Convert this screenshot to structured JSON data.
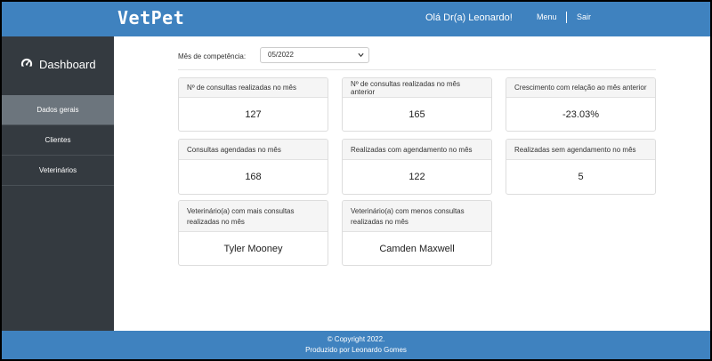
{
  "header": {
    "brand": "VetPet",
    "greeting": "Olá Dr(a) Leonardo!",
    "menu_label": "Menu",
    "logout_label": "Sair"
  },
  "sidebar": {
    "title": "Dashboard",
    "items": [
      {
        "label": "Dados gerais",
        "active": true
      },
      {
        "label": "Clientes",
        "active": false
      },
      {
        "label": "Veterinários",
        "active": false
      }
    ]
  },
  "filter": {
    "label": "Mês de competência:",
    "selected": "05/2022"
  },
  "cards": [
    {
      "title": "Nº de consultas realizadas no mês",
      "value": "127"
    },
    {
      "title": "Nº de consultas realizadas no mês anterior",
      "value": "165"
    },
    {
      "title": "Crescimento com relação ao mês anterior",
      "value": "-23.03%"
    },
    {
      "title": "Consultas agendadas no mês",
      "value": "168"
    },
    {
      "title": "Realizadas com agendamento no mês",
      "value": "122"
    },
    {
      "title": "Realizadas sem agendamento no mês",
      "value": "5"
    },
    {
      "title": "Veterinário(a) com mais consultas realizadas no mês",
      "value": "Tyler Mooney"
    },
    {
      "title": "Veterinário(a) com menos consultas realizadas no mês",
      "value": "Camden Maxwell"
    }
  ],
  "footer": {
    "copyright": "© Copyright 2022.",
    "credit": "Produzido por Leonardo Gomes"
  },
  "colors": {
    "primary": "#3f82bf",
    "sidebar": "#343a40",
    "sidebar_active": "#6c757d"
  }
}
